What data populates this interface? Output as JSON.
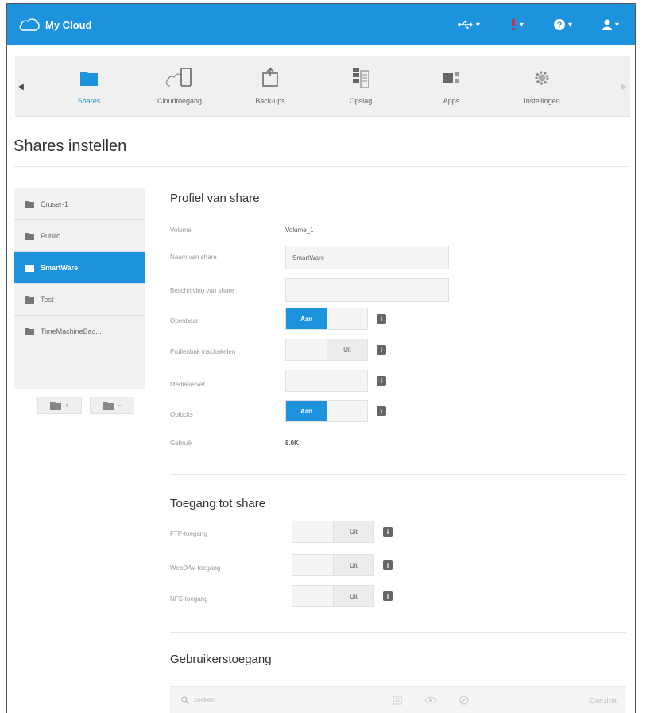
{
  "header": {
    "app_name": "My Cloud",
    "brand_color": "#1e93dd",
    "icons": {
      "usb": "usb-icon",
      "alert": "alert-icon",
      "help": "help-icon",
      "user": "user-icon"
    }
  },
  "nav": {
    "items": [
      {
        "label": "Shares",
        "icon": "folder-icon",
        "active": true
      },
      {
        "label": "Cloudtoegang",
        "icon": "cloud-device-icon",
        "active": false
      },
      {
        "label": "Back-ups",
        "icon": "backup-icon",
        "active": false
      },
      {
        "label": "Opslag",
        "icon": "storage-icon",
        "active": false
      },
      {
        "label": "Apps",
        "icon": "apps-icon",
        "active": false
      },
      {
        "label": "Instellingen",
        "icon": "gear-icon",
        "active": false
      }
    ]
  },
  "page": {
    "title": "Shares instellen"
  },
  "shares": {
    "items": [
      {
        "label": "Cruser-1"
      },
      {
        "label": "Public"
      },
      {
        "label": "SmartWare",
        "active": true
      },
      {
        "label": "Test"
      },
      {
        "label": "TimeMachineBac..."
      }
    ],
    "add_button": "+",
    "remove_button": "−"
  },
  "profile": {
    "title": "Profiel van share",
    "volume_label": "Volume",
    "volume_value": "Volume_1",
    "name_label": "Naam van share",
    "name_value": "SmartWare",
    "description_label": "Beschrijving van share",
    "description_value": "",
    "public_label": "Openbaar",
    "recycle_label": "Prullenbak inschakelen",
    "media_label": "Mediaserver",
    "oplocks_label": "Oplocks",
    "usage_label": "Gebruik",
    "usage_value": "8.0K",
    "on_label": "Aan",
    "off_label": "Uit"
  },
  "access": {
    "title": "Toegang tot share",
    "ftp_label": "FTP-toegang",
    "webdav_label": "WebDAV-toegang",
    "nfs_label": "NFS-toegang"
  },
  "user_access": {
    "title": "Gebruikerstoegang",
    "search_placeholder": "zoeken",
    "right_label": "Overzicht"
  }
}
